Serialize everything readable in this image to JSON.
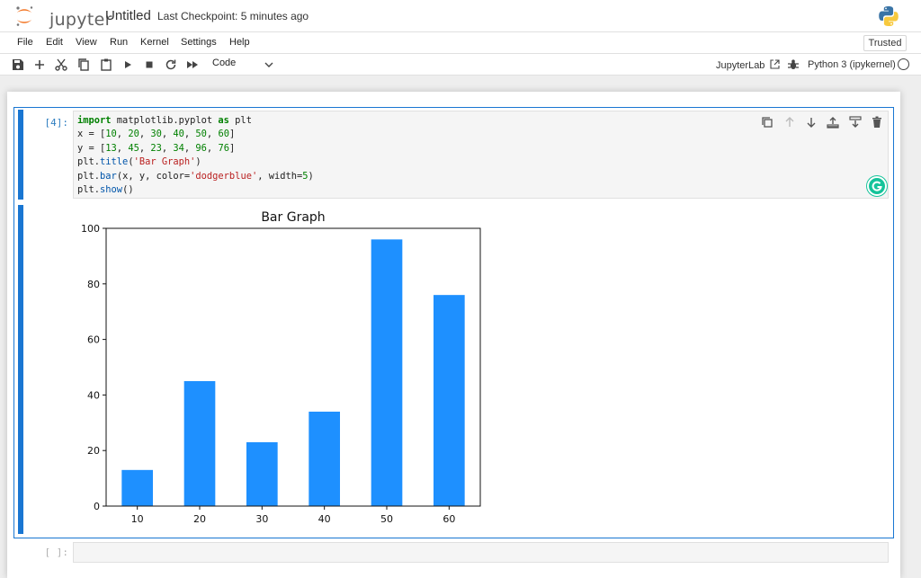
{
  "header": {
    "logo_text": "jupyter",
    "notebook_title": "Untitled",
    "checkpoint": "Last Checkpoint: 5 minutes ago"
  },
  "menu": {
    "items": [
      "File",
      "Edit",
      "View",
      "Run",
      "Kernel",
      "Settings",
      "Help"
    ],
    "trusted": "Trusted"
  },
  "toolbar": {
    "icons": [
      "save-icon",
      "add-cell-icon",
      "cut-icon",
      "copy-icon",
      "paste-icon",
      "run-icon",
      "stop-icon",
      "restart-icon",
      "fast-forward-icon"
    ],
    "cell_type": "Code",
    "jupyterlab_label": "JupyterLab",
    "kernel": "Python 3 (ipykernel)"
  },
  "cells": [
    {
      "prompt": "[4]:",
      "code_lines": [
        "import matplotlib.pyplot as plt",
        "x = [10, 20, 30, 40, 50, 60]",
        "y = [13, 45, 23, 34, 96, 76]",
        "plt.title('Bar Graph')",
        "plt.bar(x, y, color='dodgerblue', width=5)",
        "plt.show()"
      ]
    },
    {
      "prompt": "[ ]:"
    }
  ],
  "cell_toolbar": [
    "duplicate-icon",
    "move-up-icon",
    "move-down-icon",
    "insert-above-icon",
    "insert-below-icon",
    "delete-icon"
  ],
  "chart_data": {
    "type": "bar",
    "title": "Bar Graph",
    "categories": [
      "10",
      "20",
      "30",
      "40",
      "50",
      "60"
    ],
    "values": [
      13,
      45,
      23,
      34,
      96,
      76
    ],
    "color": "#1e90ff",
    "ylim": [
      0,
      100
    ],
    "yticks": [
      "0",
      "20",
      "40",
      "60",
      "80",
      "100"
    ],
    "xlabel": "",
    "ylabel": ""
  },
  "colors": {
    "accent": "#1976d2",
    "jupyter_orange": "#f37726",
    "bar": "#1e90ff"
  }
}
